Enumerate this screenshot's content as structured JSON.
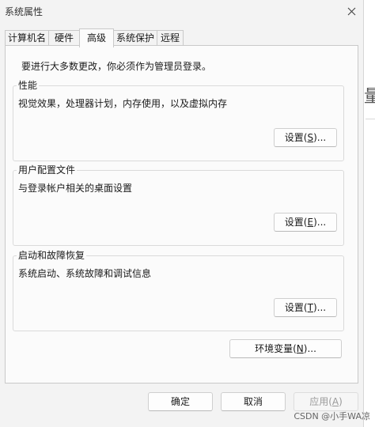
{
  "window": {
    "title": "系统属性"
  },
  "tabs": [
    {
      "label": "计算机名"
    },
    {
      "label": "硬件"
    },
    {
      "label": "高级"
    },
    {
      "label": "系统保护"
    },
    {
      "label": "远程"
    }
  ],
  "advanced": {
    "notice": "要进行大多数更改，你必须作为管理员登录。",
    "performance": {
      "title": "性能",
      "description": "视觉效果，处理器计划，内存使用，以及虚拟内存",
      "button": {
        "prefix": "设置(",
        "mnemonic": "S",
        "suffix": ")..."
      }
    },
    "user_profiles": {
      "title": "用户配置文件",
      "description": "与登录帐户相关的桌面设置",
      "button": {
        "prefix": "设置(",
        "mnemonic": "E",
        "suffix": ")..."
      }
    },
    "startup_recovery": {
      "title": "启动和故障恢复",
      "description": "系统启动、系统故障和调试信息",
      "button": {
        "prefix": "设置(",
        "mnemonic": "T",
        "suffix": ")..."
      }
    },
    "env_button": {
      "prefix": "环境变量(",
      "mnemonic": "N",
      "suffix": ")..."
    }
  },
  "footer": {
    "ok": "确定",
    "cancel": "取消",
    "apply": {
      "prefix": "应用(",
      "mnemonic": "A",
      "suffix": ")"
    }
  },
  "background": {
    "edge_glyph": "量"
  },
  "watermark": "CSDN @小手WA凉"
}
